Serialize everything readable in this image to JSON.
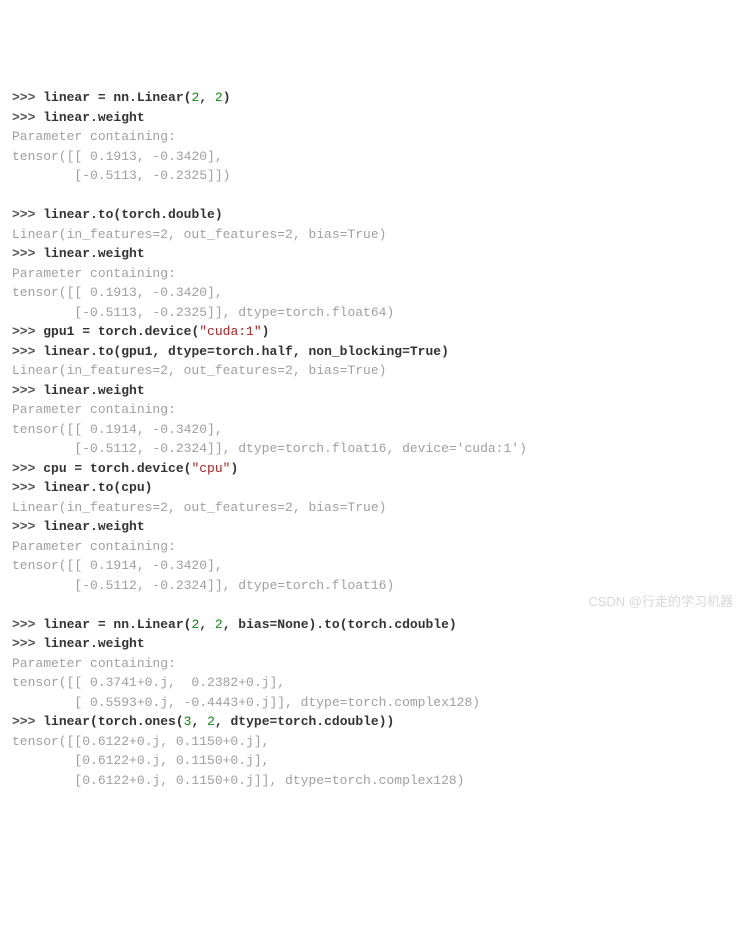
{
  "lines": [
    {
      "type": "in",
      "segs": [
        {
          "t": "prompt",
          "v": ">>> "
        },
        {
          "t": "kw",
          "v": "linear = nn.Linear("
        },
        {
          "t": "num",
          "v": "2"
        },
        {
          "t": "kw",
          "v": ", "
        },
        {
          "t": "num",
          "v": "2"
        },
        {
          "t": "kw",
          "v": ")"
        }
      ]
    },
    {
      "type": "in",
      "segs": [
        {
          "t": "prompt",
          "v": ">>> "
        },
        {
          "t": "kw",
          "v": "linear.weight"
        }
      ]
    },
    {
      "type": "out",
      "text": "Parameter containing:"
    },
    {
      "type": "out",
      "text": "tensor([[ 0.1913, -0.3420],"
    },
    {
      "type": "out",
      "text": "        [-0.5113, -0.2325]])"
    },
    {
      "type": "blank",
      "text": ""
    },
    {
      "type": "in",
      "segs": [
        {
          "t": "prompt",
          "v": ">>> "
        },
        {
          "t": "kw",
          "v": "linear.to(torch.double)"
        }
      ]
    },
    {
      "type": "out",
      "text": "Linear(in_features=2, out_features=2, bias=True)"
    },
    {
      "type": "in",
      "segs": [
        {
          "t": "prompt",
          "v": ">>> "
        },
        {
          "t": "kw",
          "v": "linear.weight"
        }
      ]
    },
    {
      "type": "out",
      "text": "Parameter containing:"
    },
    {
      "type": "out",
      "text": "tensor([[ 0.1913, -0.3420],"
    },
    {
      "type": "out",
      "text": "        [-0.5113, -0.2325]], dtype=torch.float64)"
    },
    {
      "type": "in",
      "segs": [
        {
          "t": "prompt",
          "v": ">>> "
        },
        {
          "t": "kw",
          "v": "gpu1 = torch.device("
        },
        {
          "t": "str",
          "v": "\"cuda:1\""
        },
        {
          "t": "kw",
          "v": ")"
        }
      ]
    },
    {
      "type": "in",
      "segs": [
        {
          "t": "prompt",
          "v": ">>> "
        },
        {
          "t": "kw",
          "v": "linear.to(gpu1, dtype=torch.half, non_blocking=True)"
        }
      ]
    },
    {
      "type": "out",
      "text": "Linear(in_features=2, out_features=2, bias=True)"
    },
    {
      "type": "in",
      "segs": [
        {
          "t": "prompt",
          "v": ">>> "
        },
        {
          "t": "kw",
          "v": "linear.weight"
        }
      ]
    },
    {
      "type": "out",
      "text": "Parameter containing:"
    },
    {
      "type": "out",
      "text": "tensor([[ 0.1914, -0.3420],"
    },
    {
      "type": "out",
      "text": "        [-0.5112, -0.2324]], dtype=torch.float16, device='cuda:1')"
    },
    {
      "type": "in",
      "segs": [
        {
          "t": "prompt",
          "v": ">>> "
        },
        {
          "t": "kw",
          "v": "cpu = torch.device("
        },
        {
          "t": "str",
          "v": "\"cpu\""
        },
        {
          "t": "kw",
          "v": ")"
        }
      ]
    },
    {
      "type": "in",
      "segs": [
        {
          "t": "prompt",
          "v": ">>> "
        },
        {
          "t": "kw",
          "v": "linear.to(cpu)"
        }
      ]
    },
    {
      "type": "out",
      "text": "Linear(in_features=2, out_features=2, bias=True)"
    },
    {
      "type": "in",
      "segs": [
        {
          "t": "prompt",
          "v": ">>> "
        },
        {
          "t": "kw",
          "v": "linear.weight"
        }
      ]
    },
    {
      "type": "out",
      "text": "Parameter containing:"
    },
    {
      "type": "out",
      "text": "tensor([[ 0.1914, -0.3420],"
    },
    {
      "type": "out",
      "text": "        [-0.5112, -0.2324]], dtype=torch.float16)"
    },
    {
      "type": "blank",
      "text": ""
    },
    {
      "type": "in",
      "segs": [
        {
          "t": "prompt",
          "v": ">>> "
        },
        {
          "t": "kw",
          "v": "linear = nn.Linear("
        },
        {
          "t": "num",
          "v": "2"
        },
        {
          "t": "kw",
          "v": ", "
        },
        {
          "t": "num",
          "v": "2"
        },
        {
          "t": "kw",
          "v": ", bias=None).to(torch.cdouble)"
        }
      ]
    },
    {
      "type": "in",
      "segs": [
        {
          "t": "prompt",
          "v": ">>> "
        },
        {
          "t": "kw",
          "v": "linear.weight"
        }
      ]
    },
    {
      "type": "out",
      "text": "Parameter containing:"
    },
    {
      "type": "out",
      "text": "tensor([[ 0.3741+0.j,  0.2382+0.j],"
    },
    {
      "type": "out",
      "text": "        [ 0.5593+0.j, -0.4443+0.j]], dtype=torch.complex128)"
    },
    {
      "type": "in",
      "segs": [
        {
          "t": "prompt",
          "v": ">>> "
        },
        {
          "t": "kw",
          "v": "linear(torch.ones("
        },
        {
          "t": "num",
          "v": "3"
        },
        {
          "t": "kw",
          "v": ", "
        },
        {
          "t": "num",
          "v": "2"
        },
        {
          "t": "kw",
          "v": ", dtype=torch.cdouble))"
        }
      ]
    },
    {
      "type": "out",
      "text": "tensor([[0.6122+0.j, 0.1150+0.j],"
    },
    {
      "type": "out",
      "text": "        [0.6122+0.j, 0.1150+0.j],"
    },
    {
      "type": "out",
      "text": "        [0.6122+0.j, 0.1150+0.j]], dtype=torch.complex128)"
    }
  ],
  "watermark": "CSDN @行走的学习机器"
}
